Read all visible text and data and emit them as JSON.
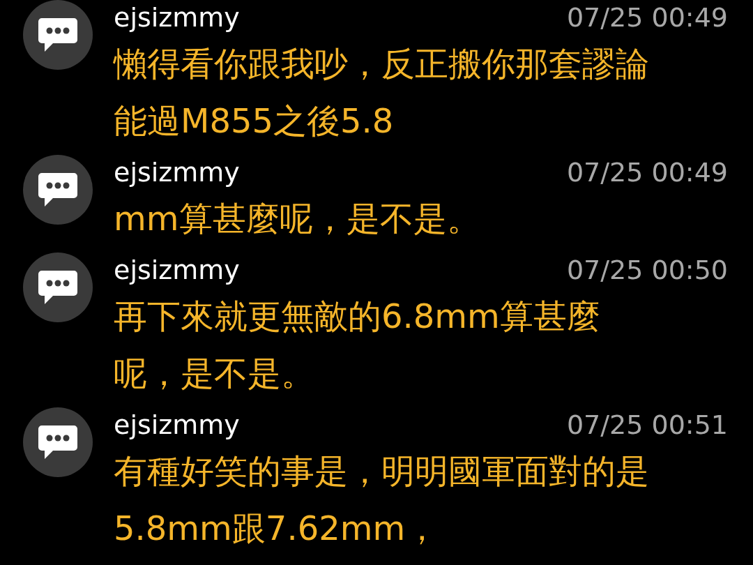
{
  "comments": [
    {
      "user": "ejsizmmy",
      "time": "07/25 00:49",
      "lines": [
        "懶得看你跟我吵，反正搬你那套謬論",
        "能過M855之後5.8"
      ]
    },
    {
      "user": "ejsizmmy",
      "time": "07/25 00:49",
      "lines": [
        "mm算甚麼呢，是不是。"
      ]
    },
    {
      "user": "ejsizmmy",
      "time": "07/25 00:50",
      "lines": [
        "再下來就更無敵的6.8mm算甚麼",
        "呢，是不是。"
      ]
    },
    {
      "user": "ejsizmmy",
      "time": "07/25 00:51",
      "lines": [
        "有種好笑的事是，明明國軍面對的是",
        "5.8mm跟7.62mm，"
      ]
    }
  ]
}
